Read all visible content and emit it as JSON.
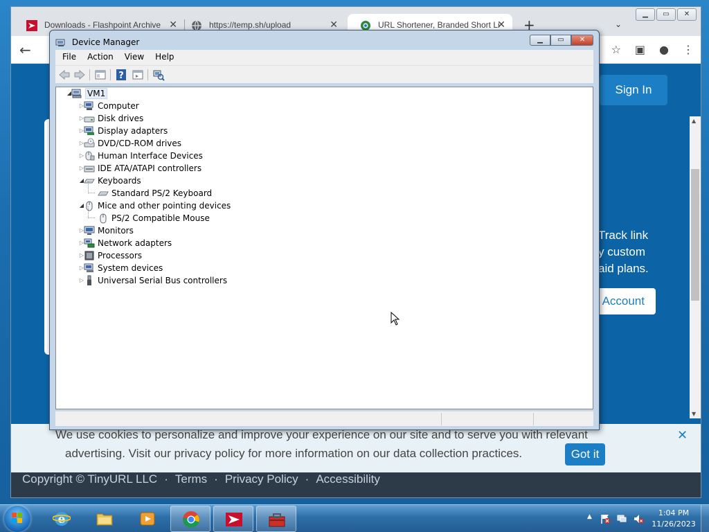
{
  "browser": {
    "tabs": [
      {
        "title": "Downloads - Flashpoint Archive",
        "close": "✕"
      },
      {
        "title": "https://temp.sh/upload",
        "close": "✕"
      },
      {
        "title": "URL Shortener, Branded Short Li",
        "close": "✕"
      }
    ],
    "new_tab": "+",
    "tab_dropdown": "⌄",
    "window_controls": {
      "minimize": "▁",
      "maximize": "▭",
      "close": "✕"
    },
    "back": "←",
    "toolbar_icons": {
      "star": "☆",
      "sidepanel": "▣",
      "profile": "●",
      "menu": "⋮"
    }
  },
  "site": {
    "sign_in": "Sign In",
    "promo_text": "Track link\ny custom\naid plans.",
    "account_button": "Account",
    "cookie_line1": "We use cookies to personalize and improve your experience on our site and to serve you with relevant",
    "cookie_line2": "advertising. Visit our privacy policy for more information on our data collection practices.",
    "cookie_button": "Got it",
    "cookie_close": "✕",
    "footer": {
      "copyright": "Copyright © TinyURL LLC",
      "sep": "·",
      "terms": "Terms",
      "privacy": "Privacy Policy",
      "accessibility": "Accessibility"
    }
  },
  "device_manager": {
    "title": "Device Manager",
    "buttons": {
      "minimize": "▁",
      "maximize": "▭",
      "close": "✕"
    },
    "menu": [
      "File",
      "Action",
      "View",
      "Help"
    ],
    "root": "VM1",
    "tree": [
      {
        "label": "Computer",
        "icon": "computer-icon",
        "expanded": false
      },
      {
        "label": "Disk drives",
        "icon": "disk-drive-icon",
        "expanded": false
      },
      {
        "label": "Display adapters",
        "icon": "display-adapter-icon",
        "expanded": false
      },
      {
        "label": "DVD/CD-ROM drives",
        "icon": "dvd-drive-icon",
        "expanded": false
      },
      {
        "label": "Human Interface Devices",
        "icon": "hid-icon",
        "expanded": false
      },
      {
        "label": "IDE ATA/ATAPI controllers",
        "icon": "ide-controller-icon",
        "expanded": false
      },
      {
        "label": "Keyboards",
        "icon": "keyboard-icon",
        "expanded": true
      },
      {
        "label": "Standard PS/2 Keyboard",
        "icon": "keyboard-icon",
        "child": true
      },
      {
        "label": "Mice and other pointing devices",
        "icon": "mouse-icon",
        "expanded": true
      },
      {
        "label": "PS/2 Compatible Mouse",
        "icon": "mouse-icon",
        "child": true
      },
      {
        "label": "Monitors",
        "icon": "monitor-icon",
        "expanded": false
      },
      {
        "label": "Network adapters",
        "icon": "network-adapter-icon",
        "expanded": false
      },
      {
        "label": "Processors",
        "icon": "processor-icon",
        "expanded": false
      },
      {
        "label": "System devices",
        "icon": "system-devices-icon",
        "expanded": false
      },
      {
        "label": "Universal Serial Bus controllers",
        "icon": "usb-icon",
        "expanded": false
      }
    ],
    "expander_closed": "▷",
    "expander_open": "◢"
  },
  "taskbar": {
    "apps": [
      "internet-explorer",
      "file-explorer",
      "media-player",
      "chrome",
      "flashpoint",
      "toolbox"
    ],
    "clock_time": "1:04 PM",
    "clock_date": "11/26/2023",
    "tray_arrow": "▲"
  },
  "colors": {
    "site_blue": "#0c63a6",
    "accent": "#1c7ec4",
    "taskbar": "#2e6ea7"
  }
}
